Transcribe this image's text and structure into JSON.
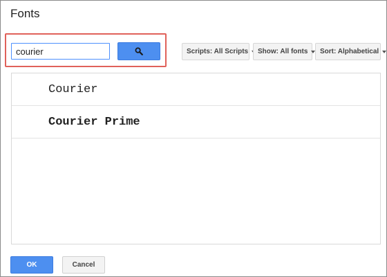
{
  "dialog": {
    "title": "Fonts"
  },
  "search": {
    "value": "courier",
    "button_icon": "search-icon"
  },
  "filters": {
    "scripts_label": "Scripts: All Scripts",
    "show_label": "Show: All fonts",
    "sort_label": "Sort: Alphabetical"
  },
  "fonts": [
    {
      "name": "Courier"
    },
    {
      "name": "Courier Prime"
    }
  ],
  "footer": {
    "ok_label": "OK",
    "cancel_label": "Cancel"
  },
  "colors": {
    "accent": "#4d8ff0",
    "highlight_border": "#e0615a"
  }
}
